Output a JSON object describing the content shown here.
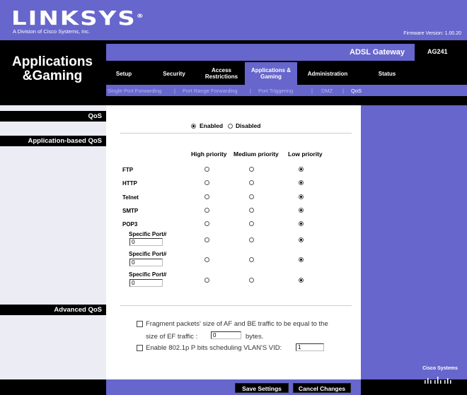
{
  "brand": {
    "logo": "LINKSYS",
    "logo_mark": "®",
    "tagline": "A Division of Cisco Systems, Inc.",
    "firmware": "Firmware Version: 1.00.20"
  },
  "header": {
    "section_title": "Applications &Gaming",
    "product": "ADSL Gateway",
    "model": "AG241"
  },
  "nav": {
    "tabs": [
      {
        "label": "Setup"
      },
      {
        "label": "Security"
      },
      {
        "label": "Access Restrictions"
      },
      {
        "label": "Applications & Gaming"
      },
      {
        "label": "Administration"
      },
      {
        "label": "Status"
      }
    ],
    "subtabs": [
      {
        "label": "Single Port Forwarding"
      },
      {
        "label": "|"
      },
      {
        "label": "Port Range Forwarding"
      },
      {
        "label": "|"
      },
      {
        "label": "Port Triggering"
      },
      {
        "label": "|"
      },
      {
        "label": "DMZ"
      },
      {
        "label": "|"
      },
      {
        "label": "QoS"
      }
    ]
  },
  "left": {
    "qos": "QoS",
    "app_qos": "Application-based QoS",
    "advanced_qos": "Advanced QoS"
  },
  "qos": {
    "enabled_label": "Enabled",
    "disabled_label": "Disabled",
    "selected": "Enabled"
  },
  "priority_table": {
    "headers": [
      "High priority",
      "Medium priority",
      "Low priority"
    ],
    "rows": [
      {
        "label": "FTP",
        "selected": "Low"
      },
      {
        "label": "HTTP",
        "selected": "Low"
      },
      {
        "label": "Telnet",
        "selected": "Low"
      },
      {
        "label": "SMTP",
        "selected": "Low"
      },
      {
        "label": "POP3",
        "selected": "Low"
      }
    ],
    "specific_ports": [
      {
        "label": "Specific Port#",
        "value": "0",
        "selected": "Low"
      },
      {
        "label": "Specific Port#",
        "value": "0",
        "selected": "Low"
      },
      {
        "label": "Specific Port#",
        "value": "0",
        "selected": "Low"
      }
    ]
  },
  "advanced": {
    "fragment_line1": "Fragment packets' size of AF and BE traffic to be equal to the",
    "fragment_line2": "size of EF traffic :",
    "fragment_value": "0",
    "fragment_unit": "bytes.",
    "vlan_label": "Enable 802.1p P bits scheduling VLAN'S VID:",
    "vlan_value": "1"
  },
  "buttons": {
    "save": "Save Settings",
    "cancel": "Cancel Changes"
  },
  "footer": {
    "cisco": "Cisco Systems"
  },
  "colors": {
    "purple": "#6666cc",
    "black": "#000000",
    "subnav_text": "#b8b8ee"
  }
}
